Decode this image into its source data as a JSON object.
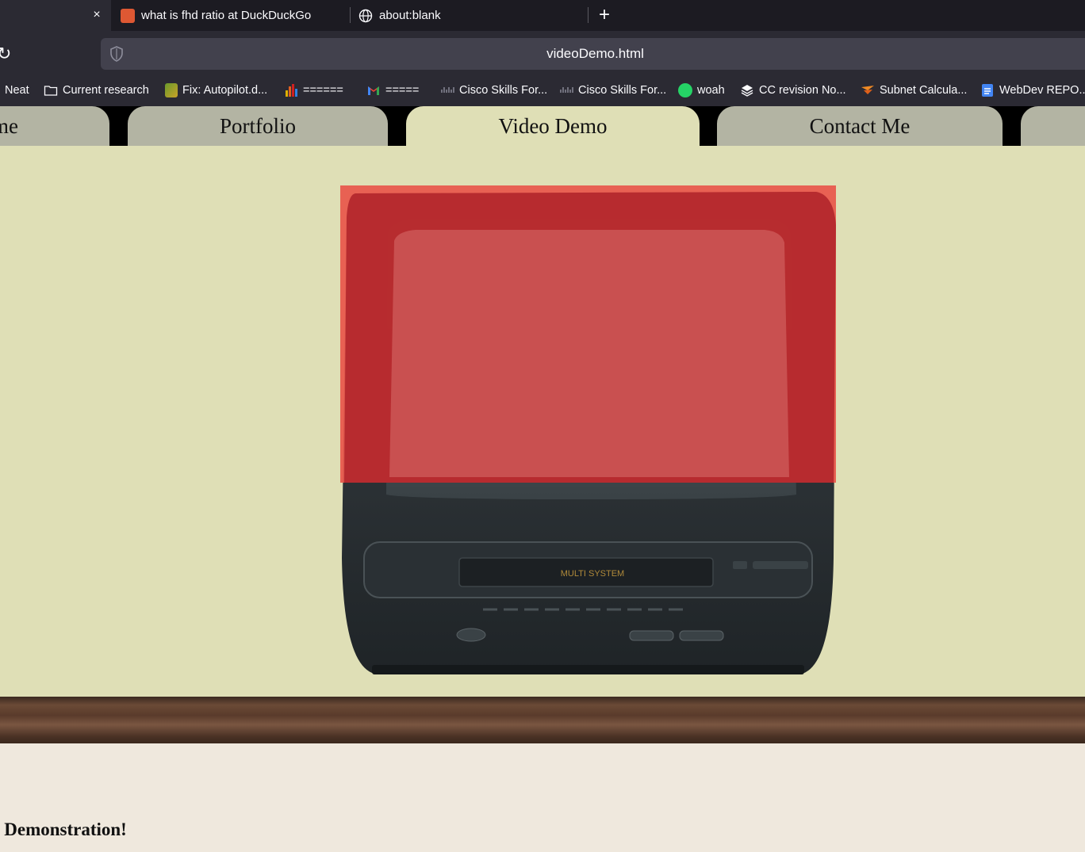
{
  "browser": {
    "tabs": [
      {
        "title": "what is fhd ratio at DuckDuckGo"
      },
      {
        "title": "about:blank"
      }
    ],
    "close_glyph": "×",
    "new_tab_glyph": "+",
    "reload_glyph": "↻",
    "url": "videoDemo.html",
    "bookmarks": [
      {
        "label": "Neat",
        "icon": "bookmark-icon"
      },
      {
        "label": "Current research",
        "icon": "folder-icon"
      },
      {
        "label": "Fix: Autopilot.d...",
        "icon": "site-icon"
      },
      {
        "label": "======",
        "icon": "chart-icon"
      },
      {
        "label": "=====",
        "icon": "gmail-icon"
      },
      {
        "label": "Cisco Skills For...",
        "icon": "cisco-icon"
      },
      {
        "label": "Cisco Skills For...",
        "icon": "cisco-icon"
      },
      {
        "label": "woah",
        "icon": "whatsapp-icon"
      },
      {
        "label": "CC revision No...",
        "icon": "layers-icon"
      },
      {
        "label": "Subnet Calcula...",
        "icon": "subnet-icon"
      },
      {
        "label": "WebDev REPO...",
        "icon": "docs-icon"
      }
    ]
  },
  "site": {
    "nav": [
      {
        "label": "me"
      },
      {
        "label": "Portfolio"
      },
      {
        "label": "Video Demo",
        "active": true
      },
      {
        "label": "Contact Me"
      },
      {
        "label": ""
      }
    ],
    "heading": "o Demonstration!",
    "tv_label": "MULTI SYSTEM"
  },
  "colors": {
    "page_bg": "#dfdfb6",
    "tab_bg": "#b3b4a3",
    "screen_overlay": "#e8564b"
  }
}
